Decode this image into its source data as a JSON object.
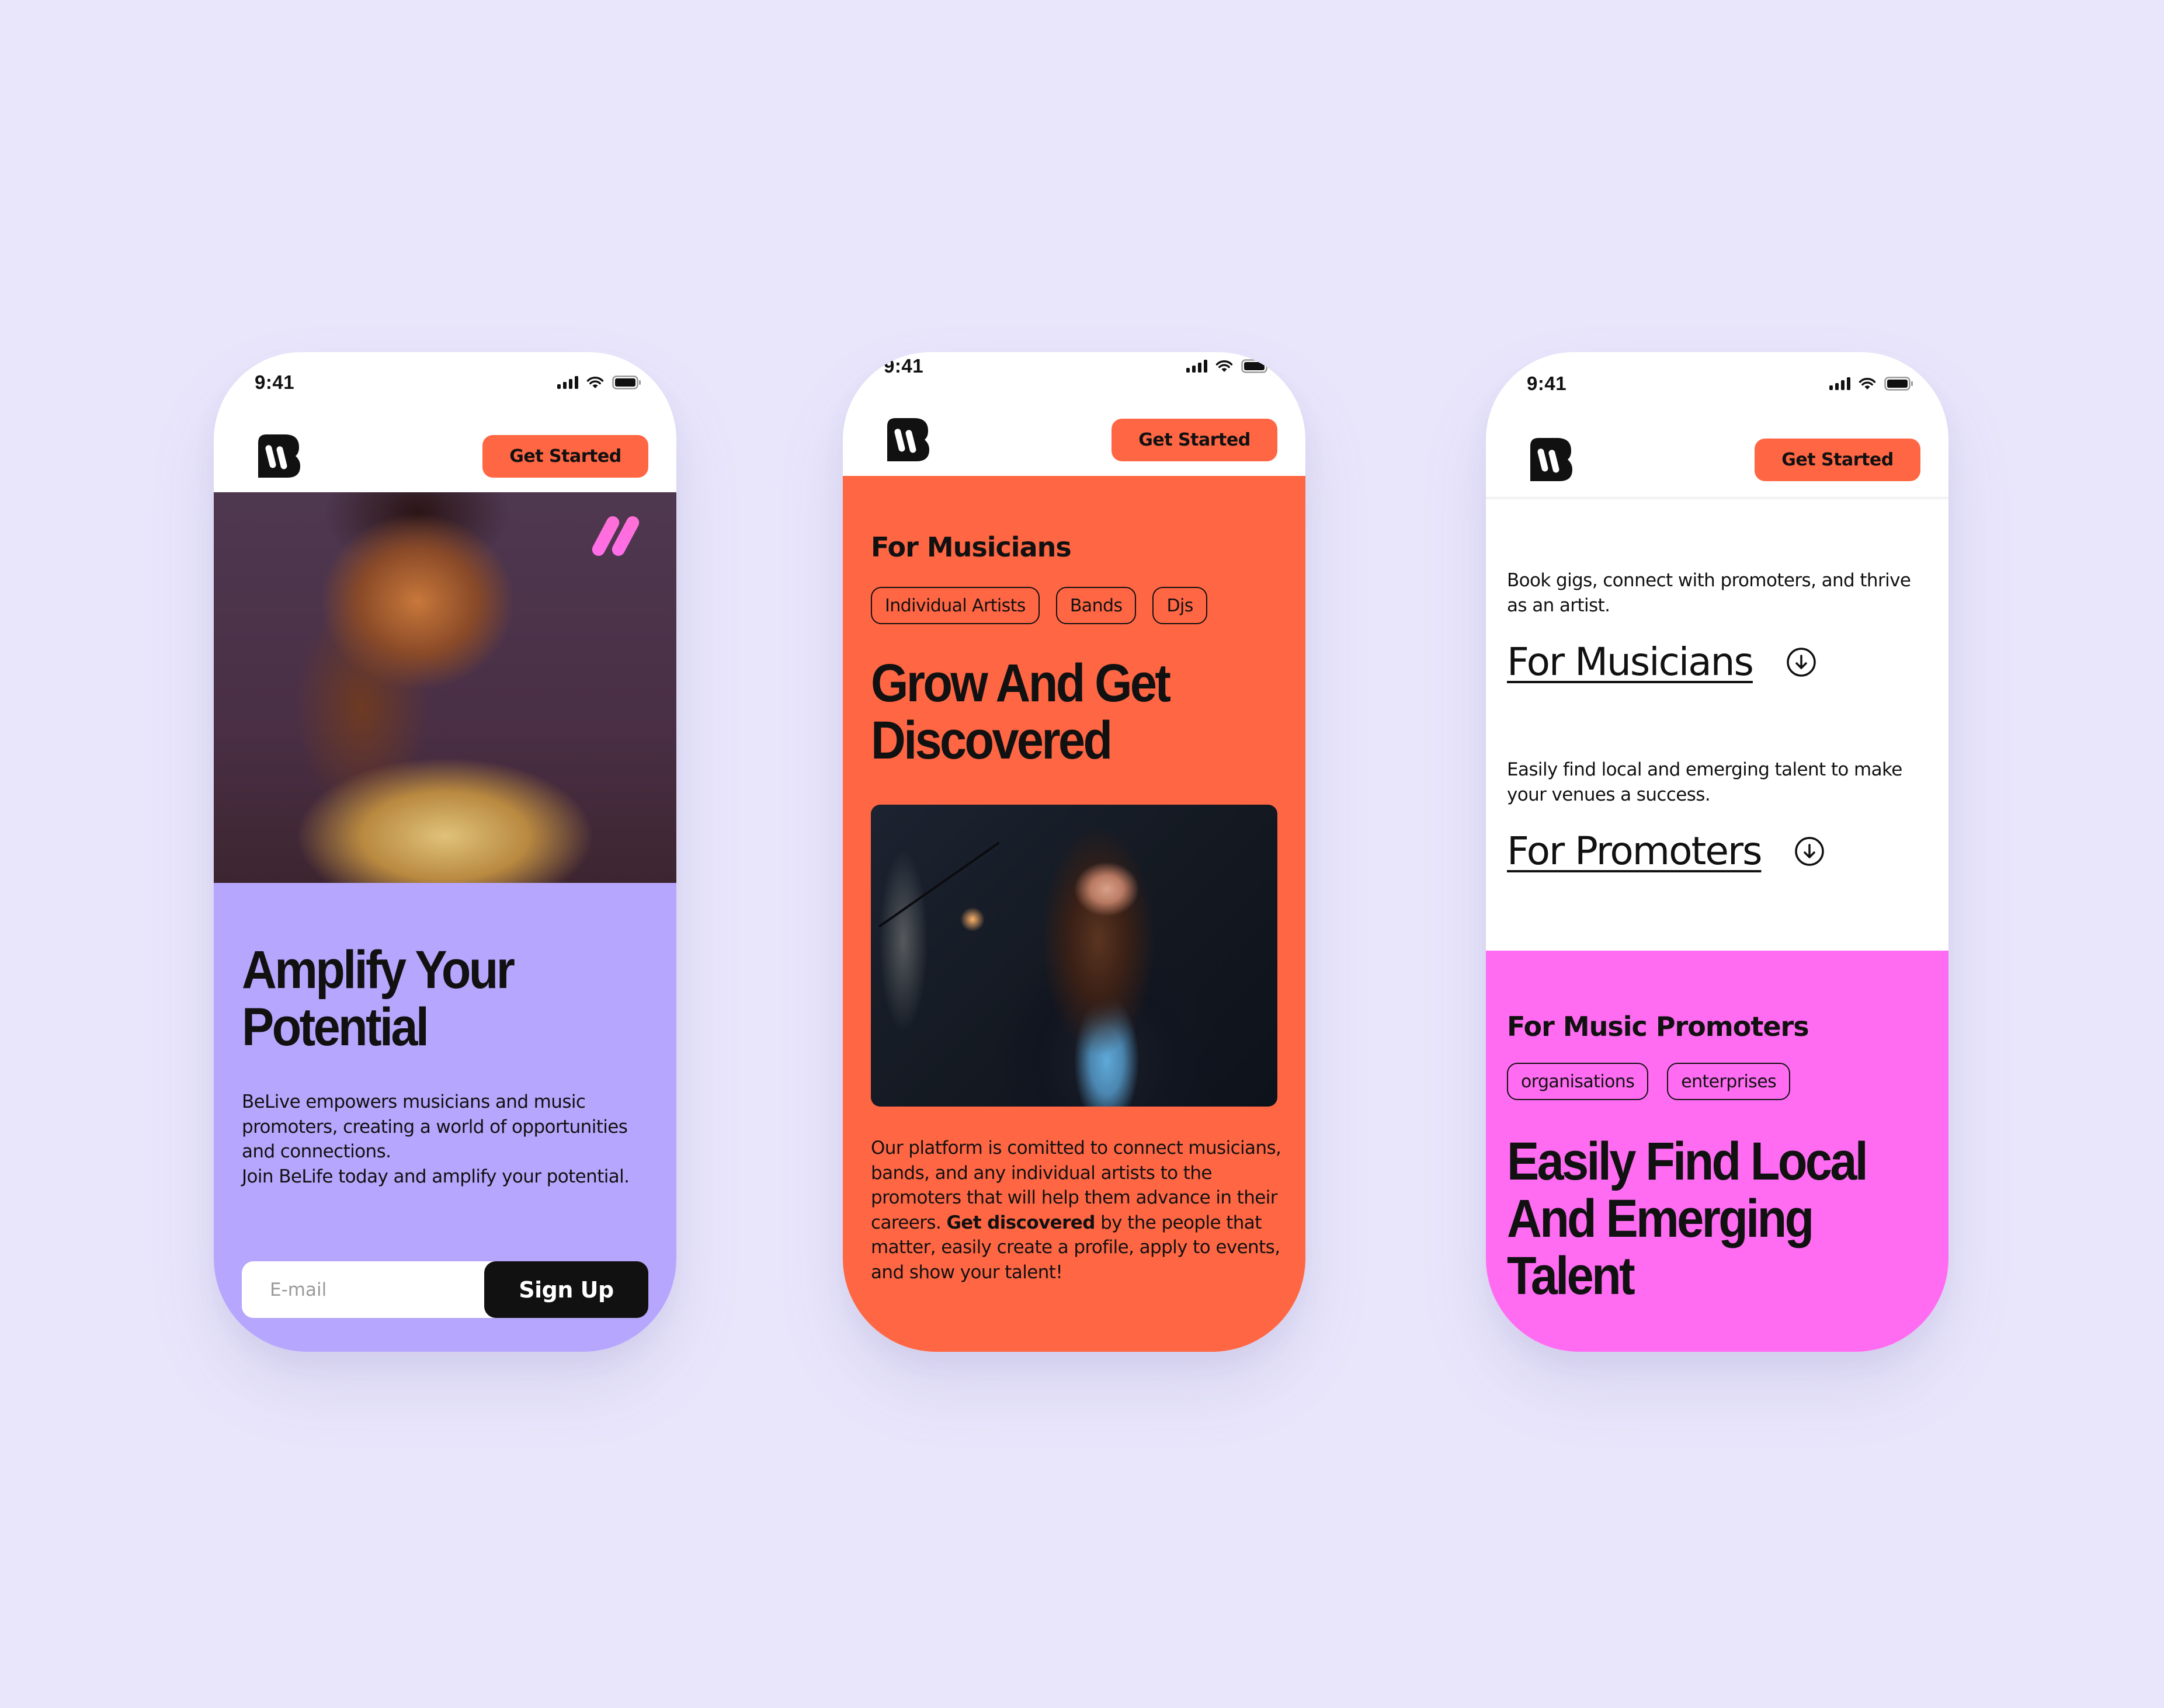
{
  "colors": {
    "background": "#e9e6fc",
    "accent_orange": "#ff6644",
    "lavender": "#b7a6fd",
    "magenta": "#ff6cf2",
    "ink": "#111111"
  },
  "status_bar": {
    "time": "9:41",
    "icons": [
      "signal-icon",
      "wifi-icon",
      "battery-icon"
    ]
  },
  "brand": {
    "logo_icon": "belive-logo-icon",
    "cta_label": "Get Started"
  },
  "phones": [
    {
      "screen": "home",
      "hero_image": "portrait-photo",
      "accent_icon": "pink-double-stroke-icon",
      "heading": "Amplify Your Potential",
      "body_lines": [
        "BeLive empowers musicians and music promoters, creating a world of opportunities and connections.",
        "Join BeLife today and amplify your potential."
      ],
      "signup": {
        "email_placeholder": "E-mail",
        "email_value": "",
        "button_label": "Sign Up"
      }
    },
    {
      "screen": "for-musicians",
      "eyebrow": "For Musicians",
      "tags": [
        "Individual Artists",
        "Bands",
        "Djs"
      ],
      "heading": "Grow And Get Discovered",
      "image": "singer-on-stage-photo",
      "body": {
        "before_bold": "Our platform is comitted to connect musicians, bands, and any individual artists to the promoters that will help them advance in their careers. ",
        "bold": "Get discovered",
        "after_bold": " by the people that matter, easily create a profile, apply to events, and show your talent!"
      }
    },
    {
      "screen": "audiences",
      "sections": [
        {
          "description": "Book gigs, connect with promoters, and thrive as an artist.",
          "link_label": "For Musicians",
          "link_icon": "arrow-down-circle-icon"
        },
        {
          "description": "Easily find local and emerging talent to make your venues a success.",
          "link_label": "For Promoters",
          "link_icon": "arrow-down-circle-icon"
        }
      ],
      "promoters_panel": {
        "eyebrow": "For Music Promoters",
        "tags": [
          "organisations",
          "enterprises"
        ],
        "heading": "Easily Find Local And Emerging Talent"
      }
    }
  ]
}
